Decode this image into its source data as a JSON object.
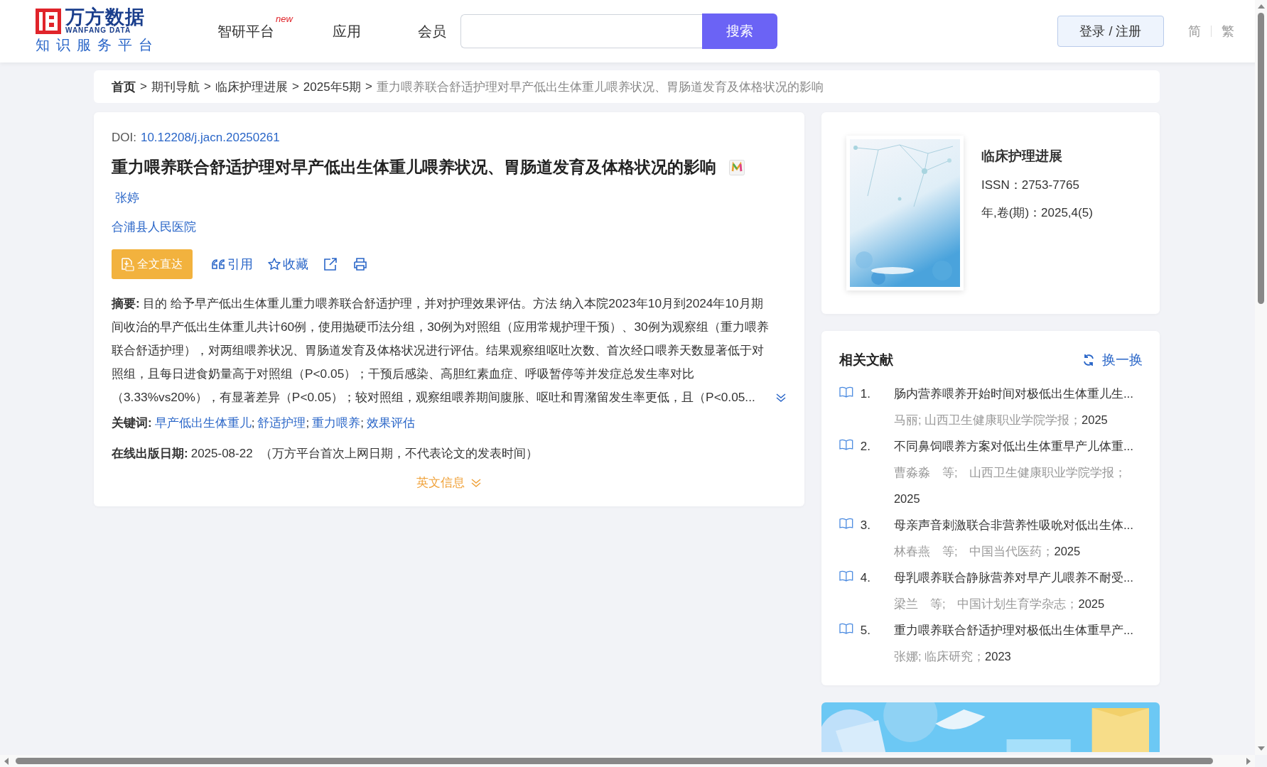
{
  "header": {
    "logo": {
      "name": "万方数据",
      "subtitle": "WANFANG DATA",
      "tagline": "知识服务平台"
    },
    "nav": [
      {
        "label": "智研平台",
        "badge": "new"
      },
      {
        "label": "应用"
      },
      {
        "label": "会员"
      }
    ],
    "search": {
      "button": "搜索"
    },
    "login": "登录 / 注册",
    "languages": [
      "简",
      "繁"
    ]
  },
  "breadcrumb": {
    "separator": ">",
    "items": [
      {
        "label": "首页",
        "kind": "home"
      },
      {
        "label": "期刊导航",
        "kind": "link"
      },
      {
        "label": "临床护理进展",
        "kind": "link"
      },
      {
        "label": "2025年5期",
        "kind": "link"
      },
      {
        "label": "重力喂养联合舒适护理对早产低出生体重儿喂养状况、胃肠道发育及体格状况的影响",
        "kind": "current"
      }
    ]
  },
  "article": {
    "doi_label": "DOI:",
    "doi": "10.12208/j.jacn.20250261",
    "title": "重力喂养联合舒适护理对早产低出生体重儿喂养状况、胃肠道发育及体格状况的影响",
    "authors": [
      "张婷"
    ],
    "affiliations": [
      "合浦县人民医院"
    ],
    "actions": {
      "fulltext": "全文直达",
      "cite": "引用",
      "favorite": "收藏"
    },
    "abstract": {
      "label": "摘要:",
      "text": "目的 给予早产低出生体重儿重力喂养联合舒适护理，并对护理效果评估。方法 纳入本院2023年10月到2024年10月期间收治的早产低出生体重儿共计60例，使用抛硬币法分组，30例为对照组（应用常规护理干预）、30例为观察组（重力喂养联合舒适护理），对两组喂养状况、胃肠道发育及体格状况进行评估。结果观察组呕吐次数、首次经口喂养天数显著低于对照组，且每日进食奶量高于对照组（P<0.05）；干预后感染、高胆红素血症、呼吸暂停等并发症总发生率对比（3.33%vs20%），有显著差异（P<0.05）；较对照组，观察组喂养期间腹胀、呕吐和胃潴留发生率更低，且（P<0.05..."
    },
    "keywords": {
      "label": "关键词:",
      "separator": ";",
      "items": [
        "早产低出生体重儿",
        "舒适护理",
        "重力喂养",
        "效果评估"
      ]
    },
    "online_date": {
      "label": "在线出版日期:",
      "value": "2025-08-22",
      "note": "（万方平台首次上网日期，不代表论文的发表时间）"
    },
    "english_info": "英文信息"
  },
  "journal": {
    "name": "临床护理进展",
    "issn": "ISSN：2753-7765",
    "volume": "年,卷(期)：2025,4(5)"
  },
  "related": {
    "title": "相关文献",
    "refresh": "换一换",
    "items": [
      {
        "number": "1.",
        "title": "肠内营养喂养开始时间对极低出生体重儿生...",
        "meta": "马丽; 山西卫生健康职业学院学报；",
        "year": "2025"
      },
      {
        "number": "2.",
        "title": "不同鼻饲喂养方案对低出生体重早产儿体重...",
        "meta": "曹淼淼　等;　山西卫生健康职业学院学报；",
        "year": "2025"
      },
      {
        "number": "3.",
        "title": "母亲声音刺激联合非营养性吸吮对低出生体...",
        "meta": "林春燕　等;　中国当代医药；",
        "year": "2025"
      },
      {
        "number": "4.",
        "title": "母乳喂养联合静脉营养对早产儿喂养不耐受...",
        "meta": "梁兰　等;　中国计划生育学杂志；",
        "year": "2025"
      },
      {
        "number": "5.",
        "title": "重力喂养联合舒适护理对极低出生体重早产...",
        "meta": "张娜; 临床研究；",
        "year": "2023"
      }
    ]
  }
}
